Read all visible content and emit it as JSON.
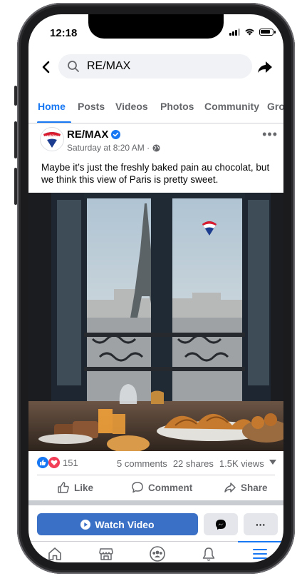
{
  "status_bar": {
    "time": "12:18"
  },
  "search": {
    "query": "RE/MAX"
  },
  "tabs": [
    {
      "label": "Home",
      "active": true
    },
    {
      "label": "Posts"
    },
    {
      "label": "Videos"
    },
    {
      "label": "Photos"
    },
    {
      "label": "Community"
    },
    {
      "label": "Gro"
    }
  ],
  "post": {
    "author": "RE/MAX",
    "timestamp": "Saturday at 8:20 AM ·",
    "avatar_text": "RE/MAX",
    "text": "Maybe it’s just the freshly baked pain au chocolat, but we think this view of Paris is pretty sweet.",
    "reactions_count": "151",
    "comments": "5 comments",
    "shares": "22 shares",
    "views": "1.5K views"
  },
  "actions": {
    "like": "Like",
    "comment": "Comment",
    "share": "Share"
  },
  "cta": {
    "watch_video": "Watch Video",
    "more": "···"
  },
  "colors": {
    "accent": "#1877f2",
    "watch_button": "#3a70c5",
    "love": "#f33e58"
  },
  "bottom_nav": [
    "home-icon",
    "marketplace-icon",
    "groups-icon",
    "notifications-icon",
    "menu-icon"
  ]
}
